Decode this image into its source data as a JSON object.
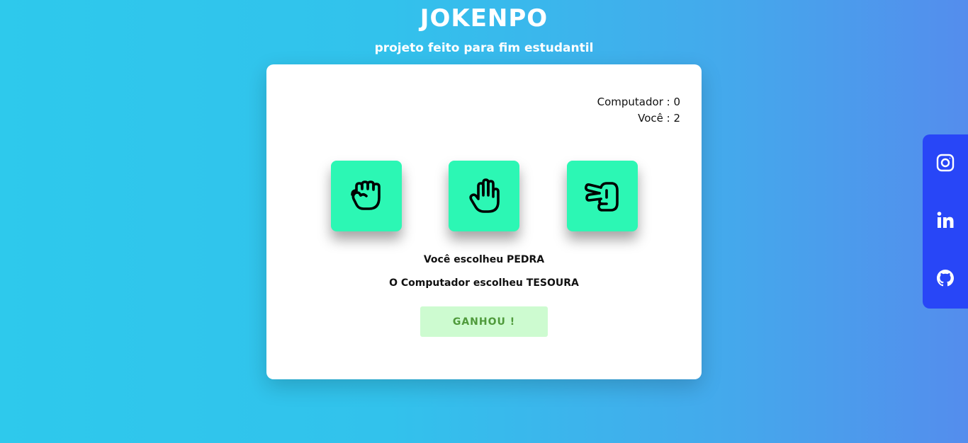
{
  "header": {
    "title": "JOKENPO",
    "subtitle": "projeto feito para fim estudantil"
  },
  "score": {
    "computer": "Computador : 0",
    "player": "Você : 2"
  },
  "choices": [
    {
      "name": "pedra",
      "icon": "rock-hand-icon"
    },
    {
      "name": "papel",
      "icon": "paper-hand-icon"
    },
    {
      "name": "tesoura",
      "icon": "scissors-hand-icon"
    }
  ],
  "result": {
    "player_choice": "Você escolheu PEDRA",
    "computer_choice": "O Computador escolheu TESOURA",
    "outcome": "GANHOU !"
  },
  "social": [
    {
      "icon": "instagram-icon"
    },
    {
      "icon": "linkedin-icon"
    },
    {
      "icon": "github-icon"
    }
  ],
  "colors": {
    "choice_bg": "#2cf7b4",
    "outcome_bg": "#cdfbd0",
    "outcome_text": "#4f9a3b",
    "social_bg": "#2846f7"
  }
}
